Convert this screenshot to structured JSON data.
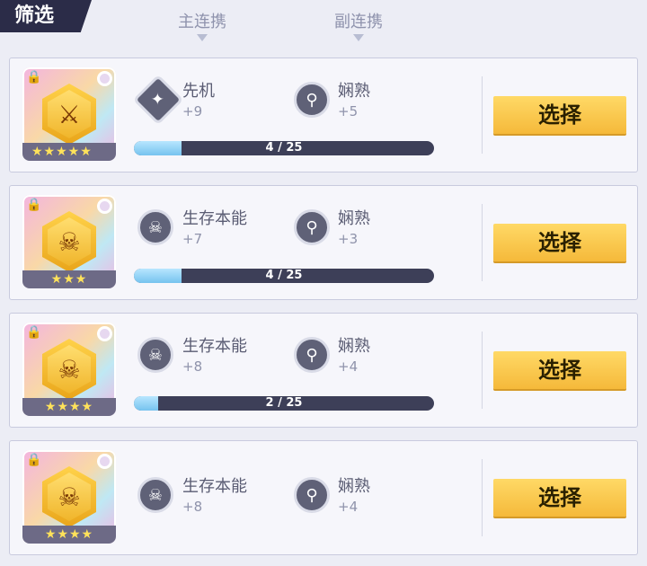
{
  "header": {
    "filter_tab": "筛选",
    "col_primary": "主连携",
    "col_secondary": "副连携"
  },
  "cards": [
    {
      "primary": {
        "name": "先机",
        "value": "+9",
        "icon": "dagger-icon"
      },
      "secondary": {
        "name": "娴熟",
        "value": "+5",
        "icon": "sword-circle-icon"
      },
      "progress": {
        "text": "4 / 25",
        "fraction": 0.16
      },
      "stars": "★★★★★",
      "select_label": "选择"
    },
    {
      "primary": {
        "name": "生存本能",
        "value": "+7",
        "icon": "skull-icon"
      },
      "secondary": {
        "name": "娴熟",
        "value": "+3",
        "icon": "sword-circle-icon"
      },
      "progress": {
        "text": "4 / 25",
        "fraction": 0.16
      },
      "stars": "★★★",
      "select_label": "选择"
    },
    {
      "primary": {
        "name": "生存本能",
        "value": "+8",
        "icon": "skull-icon"
      },
      "secondary": {
        "name": "娴熟",
        "value": "+4",
        "icon": "sword-circle-icon"
      },
      "progress": {
        "text": "2 / 25",
        "fraction": 0.08
      },
      "stars": "★★★★",
      "select_label": "选择"
    },
    {
      "primary": {
        "name": "生存本能",
        "value": "+8",
        "icon": "skull-icon"
      },
      "secondary": {
        "name": "娴熟",
        "value": "+4",
        "icon": "sword-circle-icon"
      },
      "stars": "★★★★",
      "select_label": "选择"
    }
  ],
  "colors": {
    "accent_button": "#f5b93a",
    "progress_fill": "#76c3ef",
    "progress_track": "#3d3f58"
  }
}
